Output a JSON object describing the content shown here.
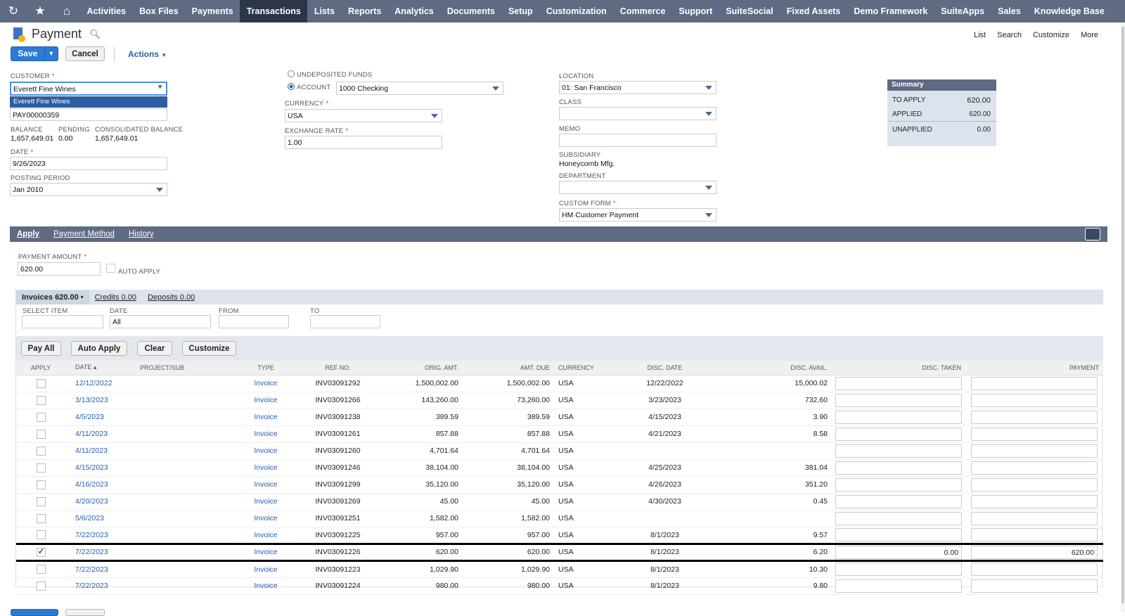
{
  "nav": {
    "items": [
      "Activities",
      "Box Files",
      "Payments",
      "Transactions",
      "Lists",
      "Reports",
      "Analytics",
      "Documents",
      "Setup",
      "Customization",
      "Commerce",
      "Support",
      "SuiteSocial",
      "Fixed Assets",
      "Demo Framework",
      "SuiteApps",
      "Sales",
      "Knowledge Base"
    ],
    "active": "Transactions"
  },
  "header": {
    "title": "Payment",
    "links": [
      "List",
      "Search",
      "Customize",
      "More"
    ],
    "save_label": "Save",
    "cancel_label": "Cancel",
    "actions_label": "Actions"
  },
  "form": {
    "customer_label": "CUSTOMER",
    "customer_value": "Everett Fine Wines",
    "customer_dropdown_option": "Everett Fine Wines",
    "ref_value": "PAY00000359",
    "balance_label": "BALANCE",
    "balance_value": "1,657,649.01",
    "pending_label": "PENDING",
    "pending_value": "0.00",
    "consolidated_label": "CONSOLIDATED BALANCE",
    "consolidated_value": "1,657,649.01",
    "date_label": "DATE",
    "date_value": "9/26/2023",
    "posting_label": "POSTING PERIOD",
    "posting_value": "Jan 2010",
    "undeposited_label": "UNDEPOSITED FUNDS",
    "account_label": "ACCOUNT",
    "account_value": "1000 Checking",
    "currency_label": "CURRENCY",
    "currency_value": "USA",
    "exchange_label": "EXCHANGE RATE",
    "exchange_value": "1.00",
    "location_label": "LOCATION",
    "location_value": "01: San Francisco",
    "class_label": "CLASS",
    "memo_label": "MEMO",
    "subsidiary_label": "SUBSIDIARY",
    "subsidiary_value": "Honeycomb Mfg.",
    "department_label": "DEPARTMENT",
    "customform_label": "CUSTOM FORM",
    "customform_value": "HM Customer Payment"
  },
  "summary": {
    "title": "Summary",
    "rows": [
      {
        "label": "TO APPLY",
        "value": "620.00"
      },
      {
        "label": "APPLIED",
        "value": "620.00"
      },
      {
        "label": "UNAPPLIED",
        "value": "0.00"
      }
    ]
  },
  "tabs": {
    "items": [
      "Apply",
      "Payment Method",
      "History"
    ],
    "active": "Apply"
  },
  "apply": {
    "payment_amount_label": "PAYMENT AMOUNT",
    "payment_amount_value": "620.00",
    "auto_apply_label": "AUTO APPLY",
    "subtabs": [
      "Invoices 620.00 •",
      "Credits 0.00",
      "Deposits 0.00"
    ],
    "filters": {
      "select_item": "SELECT ITEM",
      "date": "DATE",
      "date_value": "All",
      "from": "FROM",
      "to": "TO"
    },
    "buttons": [
      "Pay All",
      "Auto Apply",
      "Clear",
      "Customize"
    ],
    "columns": [
      "APPLY",
      "DATE ▴",
      "PROJECT/SUB",
      "TYPE",
      "REF NO.",
      "ORIG. AMT.",
      "AMT. DUE",
      "CURRENCY",
      "DISC. DATE",
      "DISC. AVAIL.",
      "DISC. TAKEN",
      "PAYMENT"
    ],
    "rows": [
      {
        "checked": false,
        "date": "12/12/2022",
        "type": "Invoice",
        "ref": "INV03091292",
        "orig": "1,500,002.00",
        "due": "1,500,002.00",
        "cur": "USA",
        "disc_date": "12/22/2022",
        "disc_avail": "15,000.02",
        "disc_taken": "",
        "payment": ""
      },
      {
        "checked": false,
        "date": "3/13/2023",
        "type": "Invoice",
        "ref": "INV03091266",
        "orig": "143,260.00",
        "due": "73,260.00",
        "cur": "USA",
        "disc_date": "3/23/2023",
        "disc_avail": "732.60",
        "disc_taken": "",
        "payment": ""
      },
      {
        "checked": false,
        "date": "4/5/2023",
        "type": "Invoice",
        "ref": "INV03091238",
        "orig": "389.59",
        "due": "389.59",
        "cur": "USA",
        "disc_date": "4/15/2023",
        "disc_avail": "3.90",
        "disc_taken": "",
        "payment": ""
      },
      {
        "checked": false,
        "date": "4/11/2023",
        "type": "Invoice",
        "ref": "INV03091261",
        "orig": "857.88",
        "due": "857.88",
        "cur": "USA",
        "disc_date": "4/21/2023",
        "disc_avail": "8.58",
        "disc_taken": "",
        "payment": ""
      },
      {
        "checked": false,
        "date": "4/11/2023",
        "type": "Invoice",
        "ref": "INV03091260",
        "orig": "4,701.64",
        "due": "4,701.64",
        "cur": "USA",
        "disc_date": "",
        "disc_avail": "",
        "disc_taken": "",
        "payment": ""
      },
      {
        "checked": false,
        "date": "4/15/2023",
        "type": "Invoice",
        "ref": "INV03091246",
        "orig": "38,104.00",
        "due": "38,104.00",
        "cur": "USA",
        "disc_date": "4/25/2023",
        "disc_avail": "381.04",
        "disc_taken": "",
        "payment": ""
      },
      {
        "checked": false,
        "date": "4/16/2023",
        "type": "Invoice",
        "ref": "INV03091299",
        "orig": "35,120.00",
        "due": "35,120.00",
        "cur": "USA",
        "disc_date": "4/26/2023",
        "disc_avail": "351.20",
        "disc_taken": "",
        "payment": ""
      },
      {
        "checked": false,
        "date": "4/20/2023",
        "type": "Invoice",
        "ref": "INV03091269",
        "orig": "45.00",
        "due": "45.00",
        "cur": "USA",
        "disc_date": "4/30/2023",
        "disc_avail": "0.45",
        "disc_taken": "",
        "payment": ""
      },
      {
        "checked": false,
        "date": "5/6/2023",
        "type": "Invoice",
        "ref": "INV03091251",
        "orig": "1,582.00",
        "due": "1,582.00",
        "cur": "USA",
        "disc_date": "",
        "disc_avail": "",
        "disc_taken": "",
        "payment": ""
      },
      {
        "checked": false,
        "date": "7/22/2023",
        "type": "Invoice",
        "ref": "INV03091225",
        "orig": "957.00",
        "due": "957.00",
        "cur": "USA",
        "disc_date": "8/1/2023",
        "disc_avail": "9.57",
        "disc_taken": "",
        "payment": ""
      },
      {
        "checked": true,
        "highlight": true,
        "date": "7/22/2023",
        "type": "Invoice",
        "ref": "INV03091226",
        "orig": "620.00",
        "due": "620.00",
        "cur": "USA",
        "disc_date": "8/1/2023",
        "disc_avail": "6.20",
        "disc_taken": "0.00",
        "payment": "620.00"
      },
      {
        "checked": false,
        "date": "7/22/2023",
        "type": "Invoice",
        "ref": "INV03091223",
        "orig": "1,029.90",
        "due": "1,029.90",
        "cur": "USA",
        "disc_date": "8/1/2023",
        "disc_avail": "10.30",
        "disc_taken": "",
        "payment": ""
      },
      {
        "checked": false,
        "date": "7/22/2023",
        "type": "Invoice",
        "ref": "INV03091224",
        "orig": "980.00",
        "due": "980.00",
        "cur": "USA",
        "disc_date": "8/1/2023",
        "disc_avail": "9.80",
        "disc_taken": "",
        "payment": ""
      }
    ]
  },
  "colors": {
    "nav_bg": "#5e6b82",
    "nav_active": "#2c3648",
    "primary": "#2d79d6",
    "link": "#2360ad"
  }
}
